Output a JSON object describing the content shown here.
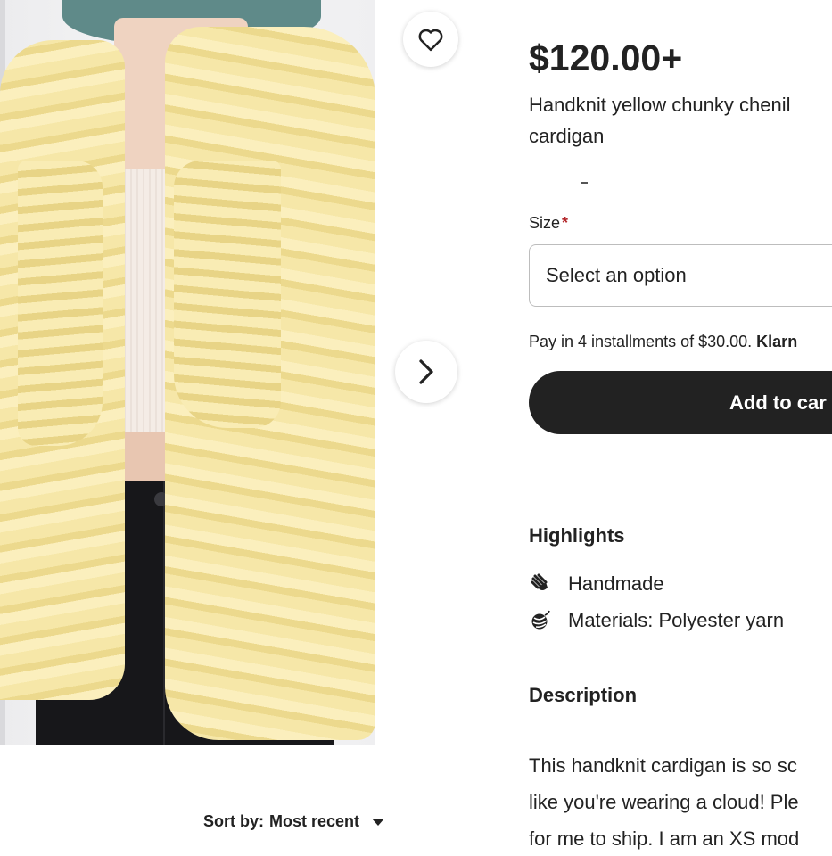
{
  "gallery": {
    "favorite_icon": "heart-icon",
    "next_icon": "chevron-right-icon"
  },
  "reviews": {
    "sort_label": "Sort by:",
    "sort_value": "Most recent"
  },
  "product": {
    "price": "$120.00+",
    "title_line1": "Handknit yellow chunky chenil",
    "title_line2": "cardigan"
  },
  "size": {
    "label": "Size",
    "required_mark": "*",
    "placeholder": "Select an option"
  },
  "klarna": {
    "text": "Pay in 4 installments of $30.00.",
    "brand": "Klarn"
  },
  "cart": {
    "button_label": "Add to car"
  },
  "highlights": {
    "heading": "Highlights",
    "items": [
      {
        "icon": "hand-wave-icon",
        "text": "Handmade"
      },
      {
        "icon": "yarn-ball-icon",
        "text": "Materials: Polyester yarn"
      }
    ]
  },
  "description": {
    "heading": "Description",
    "lines": [
      "This handknit cardigan is so sc",
      "like you're wearing a cloud! Ple",
      "for me to ship. I am an XS mod"
    ]
  },
  "colors": {
    "text": "#222222",
    "button_bg": "#222222",
    "required": "#b3262a"
  }
}
